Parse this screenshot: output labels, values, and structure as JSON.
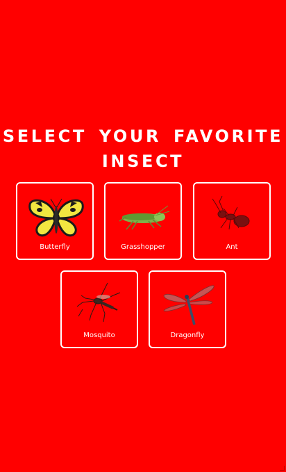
{
  "page": {
    "title": "SELECT YOUR FAVORITE INSECT"
  },
  "colors": {
    "background": "#ff0000",
    "text": "#ffffff",
    "card_border": "#ffffff"
  },
  "insects": [
    {
      "label": "Butterfly",
      "icon": "butterfly-icon"
    },
    {
      "label": "Grasshopper",
      "icon": "grasshopper-icon"
    },
    {
      "label": "Ant",
      "icon": "ant-icon"
    },
    {
      "label": "Mosquito",
      "icon": "mosquito-icon"
    },
    {
      "label": "Dragonfly",
      "icon": "dragonfly-icon"
    }
  ]
}
